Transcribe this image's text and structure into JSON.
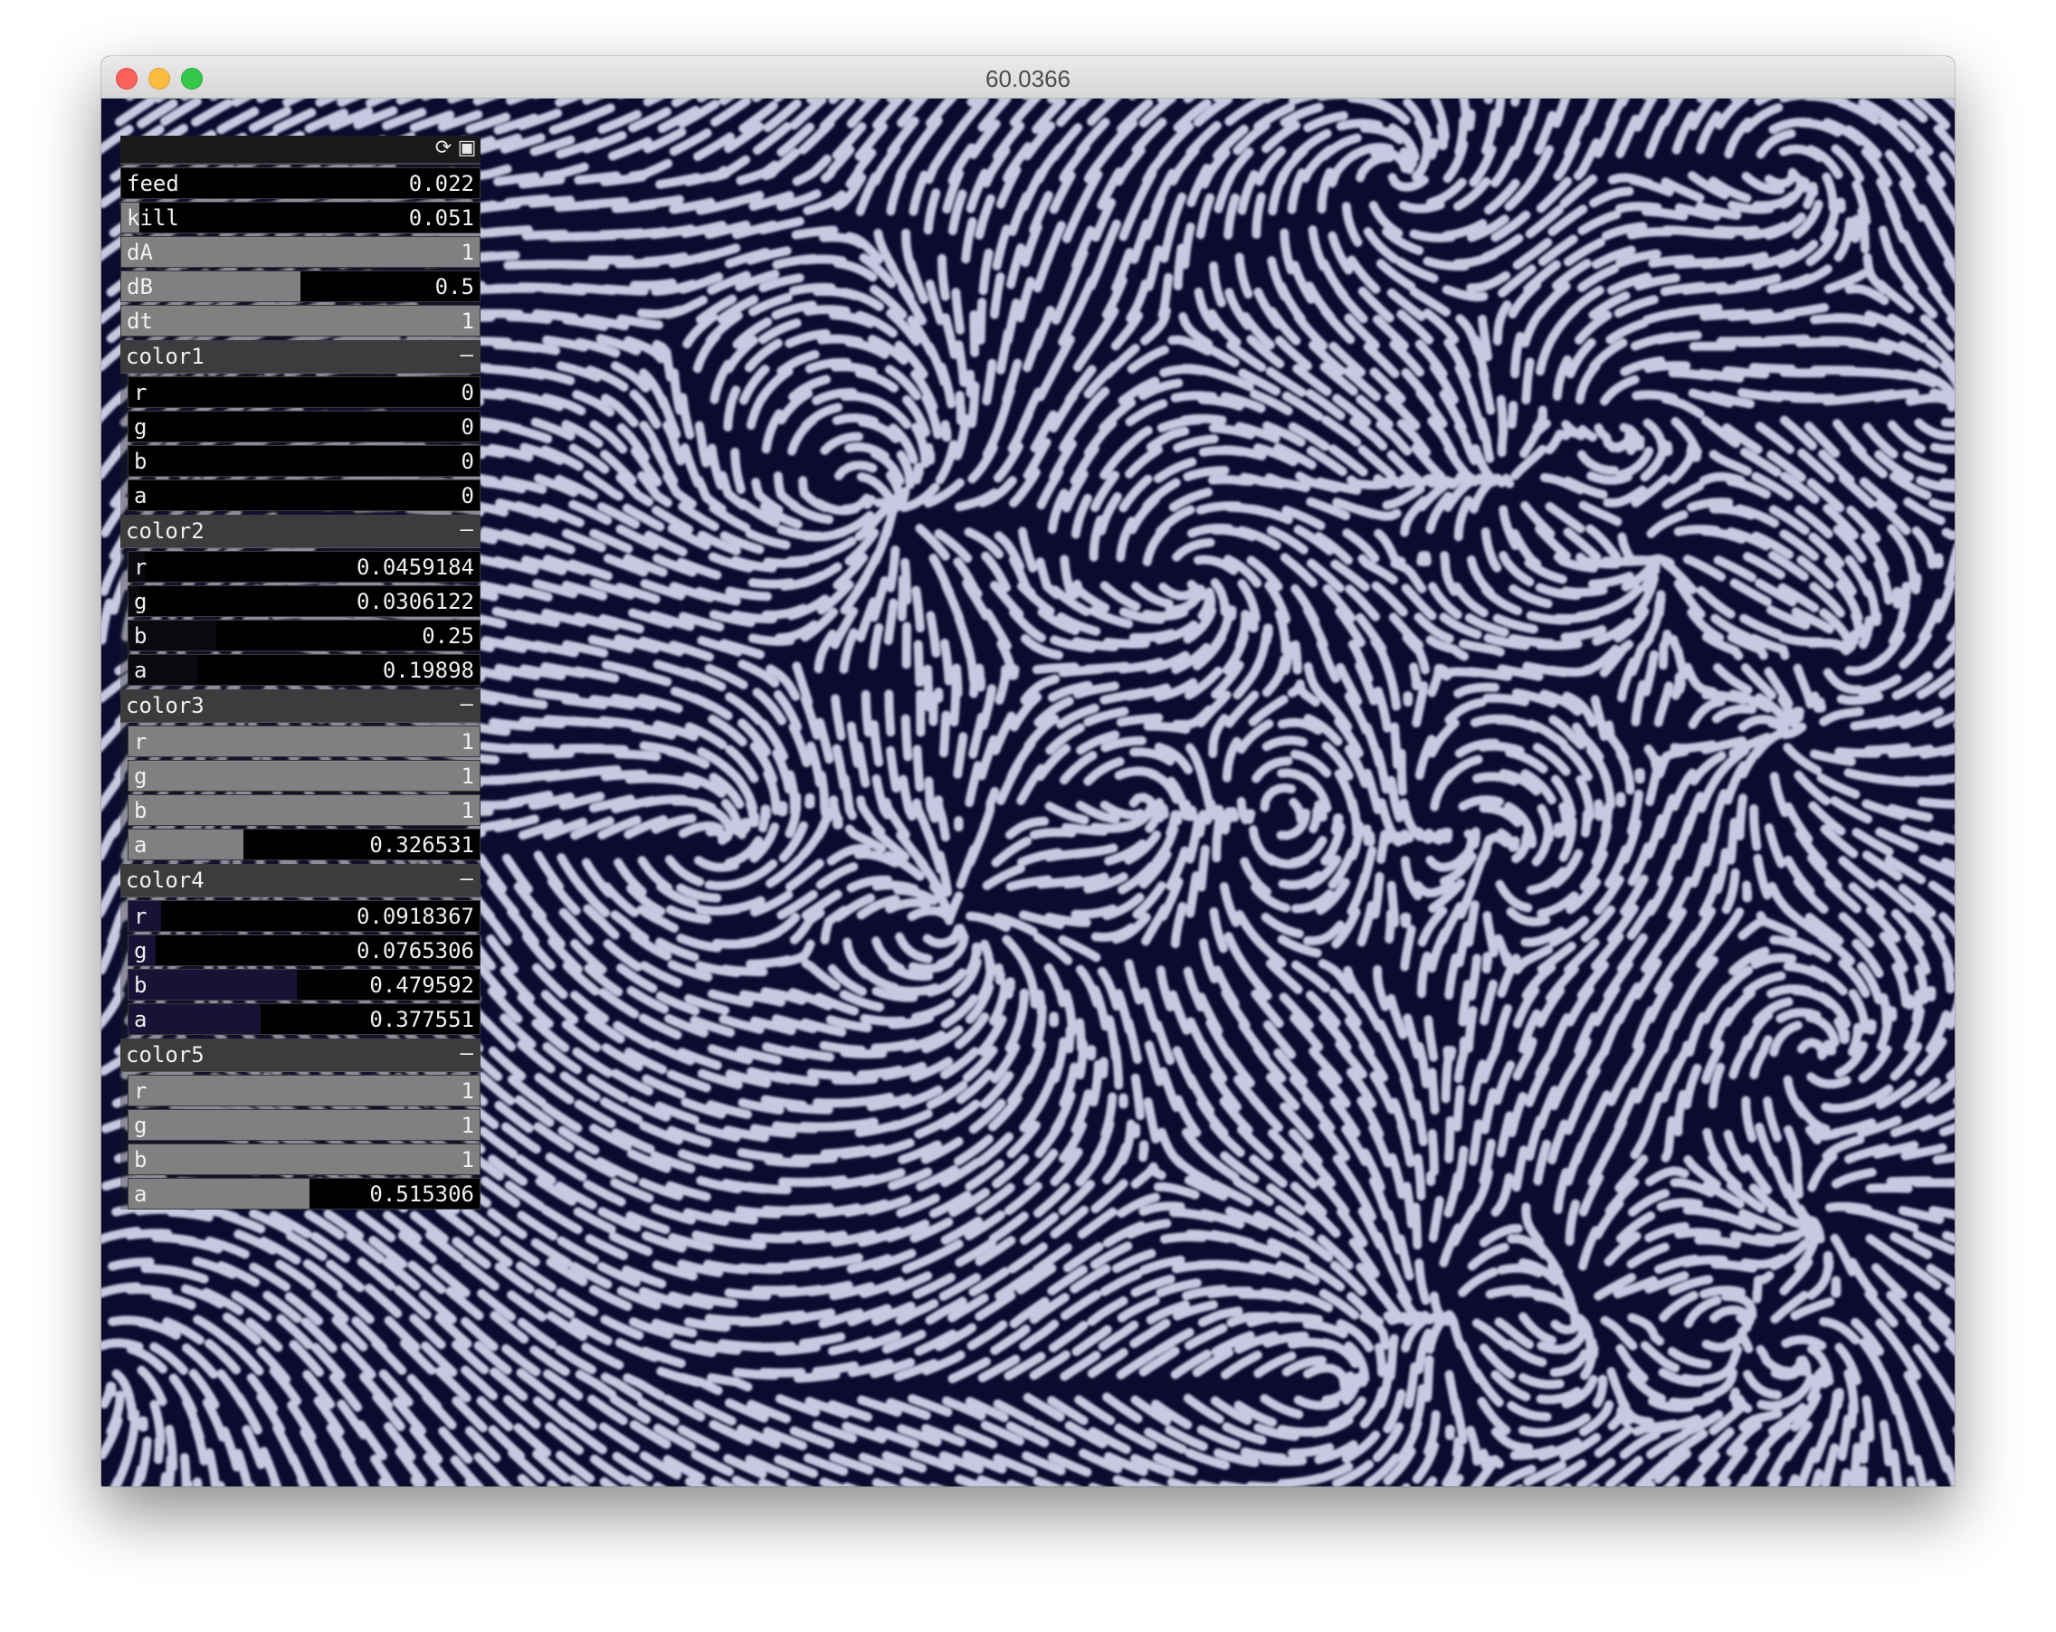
{
  "window": {
    "title": "60.0366"
  },
  "panel": {
    "params": [
      {
        "label": "feed",
        "value": "0.022",
        "level": 0.0
      },
      {
        "label": "kill",
        "value": "0.051",
        "level": 0.05
      },
      {
        "label": "dA",
        "value": "1",
        "level": 1.0
      },
      {
        "label": "dB",
        "value": "0.5",
        "level": 0.5
      },
      {
        "label": "dt",
        "value": "1",
        "level": 1.0
      }
    ],
    "groups": [
      {
        "name": "color1",
        "collapse": "–",
        "channels": [
          {
            "label": "r",
            "value": "0",
            "level": 0.0,
            "color": "#000000"
          },
          {
            "label": "g",
            "value": "0",
            "level": 0.0,
            "color": "#000000"
          },
          {
            "label": "b",
            "value": "0",
            "level": 0.0,
            "color": "#000000"
          },
          {
            "label": "a",
            "value": "0",
            "level": 0.0,
            "color": "#000000"
          }
        ]
      },
      {
        "name": "color2",
        "collapse": "–",
        "channels": [
          {
            "label": "r",
            "value": "0.0459184",
            "level": 0.0459184,
            "color": "#0b0810"
          },
          {
            "label": "g",
            "value": "0.0306122",
            "level": 0.0306122,
            "color": "#0b0810"
          },
          {
            "label": "b",
            "value": "0.25",
            "level": 0.25,
            "color": "#0b0810"
          },
          {
            "label": "a",
            "value": "0.19898",
            "level": 0.19898,
            "color": "#0b0810"
          }
        ]
      },
      {
        "name": "color3",
        "collapse": "–",
        "channels": [
          {
            "label": "r",
            "value": "1",
            "level": 1.0,
            "color": "#808080"
          },
          {
            "label": "g",
            "value": "1",
            "level": 1.0,
            "color": "#808080"
          },
          {
            "label": "b",
            "value": "1",
            "level": 1.0,
            "color": "#808080"
          },
          {
            "label": "a",
            "value": "0.326531",
            "level": 0.326531,
            "color": "#808080"
          }
        ]
      },
      {
        "name": "color4",
        "collapse": "–",
        "channels": [
          {
            "label": "r",
            "value": "0.0918367",
            "level": 0.0918367,
            "color": "#171336"
          },
          {
            "label": "g",
            "value": "0.0765306",
            "level": 0.0765306,
            "color": "#171336"
          },
          {
            "label": "b",
            "value": "0.479592",
            "level": 0.479592,
            "color": "#171336"
          },
          {
            "label": "a",
            "value": "0.377551",
            "level": 0.377551,
            "color": "#171336"
          }
        ]
      },
      {
        "name": "color5",
        "collapse": "–",
        "channels": [
          {
            "label": "r",
            "value": "1",
            "level": 1.0,
            "color": "#808080"
          },
          {
            "label": "g",
            "value": "1",
            "level": 1.0,
            "color": "#808080"
          },
          {
            "label": "b",
            "value": "1",
            "level": 1.0,
            "color": "#808080"
          },
          {
            "label": "a",
            "value": "0.515306",
            "level": 0.515306,
            "color": "#808080"
          }
        ]
      }
    ]
  },
  "colors": {
    "canvas_bg": "#0b0b30",
    "pattern_stripe": "#c8c8e0",
    "param_fill": "#808080"
  },
  "icons": {
    "reload": "reload-icon",
    "save": "save-icon"
  }
}
